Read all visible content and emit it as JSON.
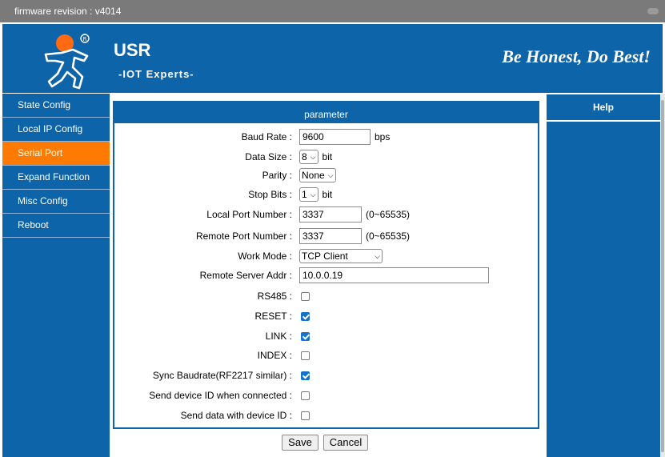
{
  "topbar": {
    "firmware": "firmware revision : v4014"
  },
  "header": {
    "brand": "USR",
    "tagline": "-IOT Experts-",
    "motto": "Be Honest, Do Best!"
  },
  "sidebar": {
    "items": [
      {
        "label": "State Config"
      },
      {
        "label": "Local IP Config"
      },
      {
        "label": "Serial Port"
      },
      {
        "label": "Expand Function"
      },
      {
        "label": "Misc Config"
      },
      {
        "label": "Reboot"
      }
    ]
  },
  "main": {
    "title": "parameter"
  },
  "form": {
    "baud_rate": {
      "label": "Baud Rate :",
      "value": "9600",
      "unit": "bps"
    },
    "data_size": {
      "label": "Data Size :",
      "value": "8",
      "unit": "bit"
    },
    "parity": {
      "label": "Parity :",
      "value": "None"
    },
    "stop_bits": {
      "label": "Stop Bits :",
      "value": "1",
      "unit": "bit"
    },
    "local_port": {
      "label": "Local Port Number :",
      "value": "3337",
      "range": "(0~65535)"
    },
    "remote_port": {
      "label": "Remote Port Number :",
      "value": "3337",
      "range": "(0~65535)"
    },
    "work_mode": {
      "label": "Work Mode :",
      "value": "TCP Client"
    },
    "remote_addr": {
      "label": "Remote Server Addr :",
      "value": "10.0.0.19"
    },
    "rs485": {
      "label": "RS485 :",
      "checked": false
    },
    "reset": {
      "label": "RESET :",
      "checked": true
    },
    "link": {
      "label": "LINK :",
      "checked": true
    },
    "index": {
      "label": "INDEX :",
      "checked": false
    },
    "sync_baudrate": {
      "label": "Sync Baudrate(RF2217 similar) :",
      "checked": true
    },
    "send_id_connected": {
      "label": "Send device ID when connected :",
      "checked": false
    },
    "send_data_id": {
      "label": "Send data with device ID :",
      "checked": false
    }
  },
  "buttons": {
    "save": "Save",
    "cancel": "Cancel"
  },
  "help": {
    "title": "Help"
  },
  "colors": {
    "brand_blue": "#0e64a8",
    "active_orange": "#ff7a00",
    "logo_orange": "#ff6a13"
  },
  "icons": {
    "logo": "running-figure-logo"
  }
}
